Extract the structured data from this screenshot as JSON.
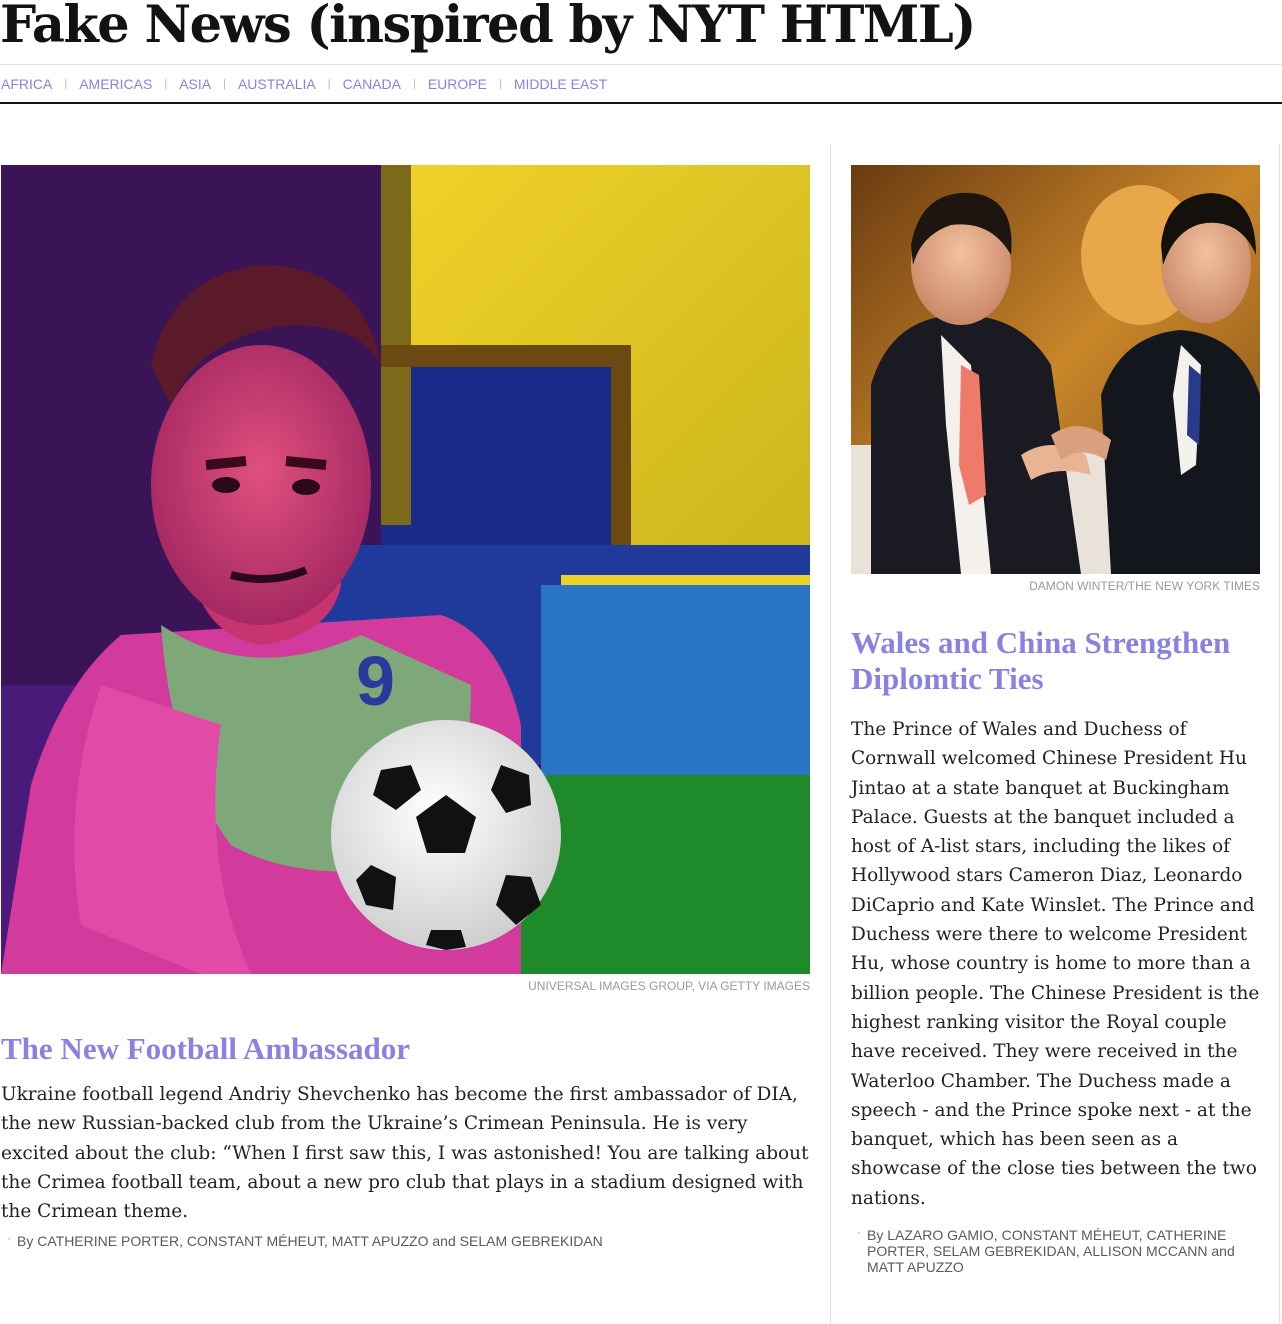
{
  "masthead": {
    "title": "Fake News (inspired by NYT HTML)"
  },
  "nav": {
    "items": [
      {
        "label": "Africa"
      },
      {
        "label": "Americas"
      },
      {
        "label": "Asia"
      },
      {
        "label": "Australia"
      },
      {
        "label": "Canada"
      },
      {
        "label": "Europe"
      },
      {
        "label": "Middle East"
      }
    ],
    "separator": "|"
  },
  "colors": {
    "accent": "#8a82e0",
    "text": "#222222",
    "rule": "#121212"
  },
  "stories": [
    {
      "image": {
        "icon": "football-player-image"
      },
      "credit": "Universal Images Group, via Getty Images",
      "headline": "The New Football Ambassador",
      "summary": "Ukraine football legend Andriy Shevchenko has become the first ambassador of DIA, the new Russian-backed club from the Ukraine’s Crimean Peninsula. He is very excited about the club: “When I first saw this, I was astonished! You are talking about the Crimea football team, about a new pro club that plays in a stadium designed with the Crimean theme.",
      "byline": {
        "prefix": "By",
        "names": "Catherine Porter, Constant Méheut, Matt Apuzzo",
        "and": "and",
        "last": "Selam Gebrekidan"
      }
    },
    {
      "image": {
        "icon": "diplomats-meeting-image"
      },
      "credit": "Damon Winter/The New York Times",
      "headline": "Wales and China Strengthen Diplomtic Ties",
      "summary": "The Prince of Wales and Duchess of Cornwall welcomed Chinese President Hu Jintao at a state banquet at Buckingham Palace. Guests at the banquet included a host of A-list stars, including the likes of Hollywood stars Cameron Diaz, Leonardo DiCaprio and Kate Winslet. The Prince and Duchess were there to welcome President Hu, whose country is home to more than a billion people. The Chinese President is the highest ranking visitor the Royal couple have received. They were received in the Waterloo Chamber. The Duchess made a speech - and the Prince spoke next - at the banquet, which has been seen as a showcase of the close ties between the two nations.",
      "byline": {
        "prefix": "By",
        "names": "Lazaro Gamio, Constant Méheut, Catherine Porter, Selam Gebrekidan, Allison McCann",
        "and": "and",
        "last": "Matt Apuzzo"
      }
    }
  ]
}
